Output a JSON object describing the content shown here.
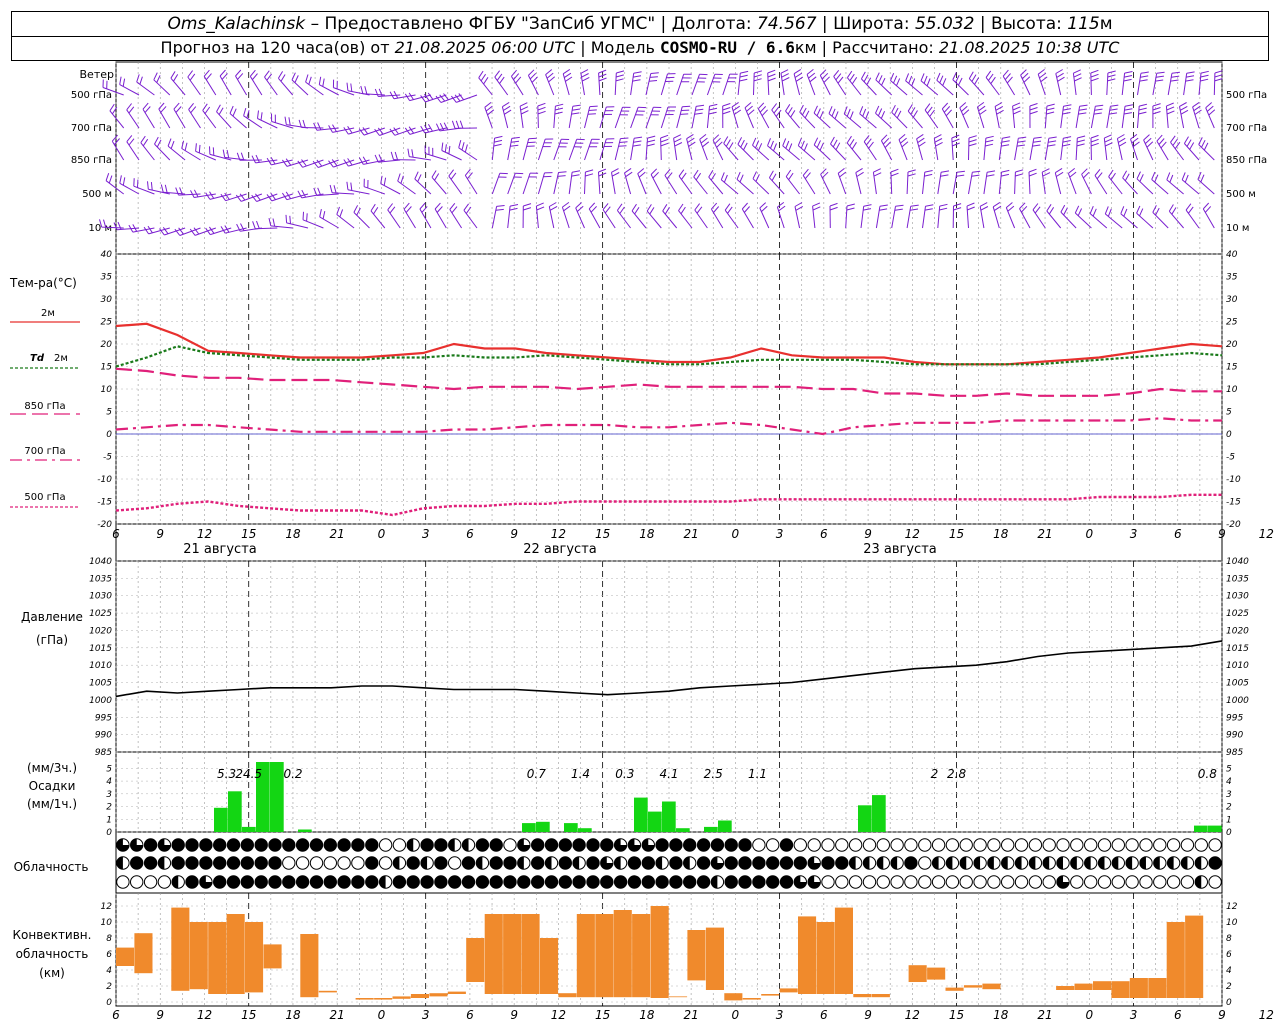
{
  "header": {
    "station": "Oms_Kalachinsk",
    "provider": "– Предоставлено ФГБУ \"ЗапСиб УГМС\"",
    "lon_label": "Долгота:",
    "lon": "74.567",
    "lat_label": "Широта:",
    "lat": "55.032",
    "alt_label": "Высота:",
    "alt": "115",
    "alt_unit": "м",
    "forecast_prefix": "Прогноз на 120 часа(ов) от",
    "forecast_time": "21.08.2025 06:00 UTC",
    "model_label": "Модель",
    "model": "COSMO-RU / 6.6",
    "model_unit": "км",
    "computed_label": "Рассчитано:",
    "computed": "21.08.2025 10:38 UTC"
  },
  "labels": {
    "wind": "Ветер",
    "levels": [
      "500 гПа",
      "700 гПа",
      "850 гПа",
      "500 м",
      "10 м"
    ],
    "temp_title": "Тем-ра(°С)",
    "legend_2m": "2м",
    "legend_td_a": "Td",
    "legend_td_b": "2м",
    "legend_850": "850 гПа",
    "legend_700": "700 гПа",
    "legend_500": "500 гПа",
    "pressure_title": "Давление",
    "pressure_unit": "(гПа)",
    "precip_unit1": "(мм/3ч.)",
    "precip_title": "Осадки",
    "precip_unit2": "(мм/1ч.)",
    "cloud_title": "Облачность",
    "conv_title1": "Конвективн.",
    "conv_title2": "облачность",
    "conv_title3": "(км)",
    "dates": [
      "21 августа",
      "22 августа",
      "23 августа"
    ]
  },
  "chart_data": [
    {
      "type": "line",
      "panel": "temperature",
      "title": "Тем-ра(°С)",
      "ylim": [
        -20,
        40
      ],
      "x_hours": [
        0,
        3,
        6,
        9,
        12,
        15,
        18,
        21,
        24,
        27,
        30,
        33,
        36,
        39,
        42,
        45,
        48,
        51,
        54,
        57,
        60,
        63,
        66,
        69,
        72,
        75,
        78,
        81,
        84,
        87,
        90,
        93,
        96,
        99,
        102,
        105,
        108,
        111,
        114,
        117,
        120,
        123,
        126,
        129,
        132,
        135,
        138,
        141,
        144
      ],
      "x_ticks": [
        "6",
        "9",
        "12",
        "15",
        "18",
        "21",
        "0",
        "3",
        "6",
        "9",
        "12",
        "15",
        "18",
        "21",
        "0",
        "3",
        "6",
        "9",
        "12",
        "15",
        "18",
        "21",
        "0",
        "3",
        "6",
        "9",
        "12"
      ],
      "series": [
        {
          "name": "2м",
          "color": "#e8302e",
          "values": [
            24,
            24.5,
            22,
            18.5,
            18,
            17.5,
            17,
            17,
            17,
            17.5,
            18,
            20,
            19,
            19,
            18,
            17.5,
            17,
            16.5,
            16,
            16,
            17,
            19,
            17.5,
            17,
            17,
            17,
            16,
            15.5,
            15.5,
            15.5,
            16,
            16.5,
            17,
            18,
            19,
            20,
            19.5
          ]
        },
        {
          "name": "Td 2м",
          "color": "#1a7a1a",
          "values": [
            15,
            17,
            19.5,
            18,
            17.5,
            17,
            16.5,
            16.5,
            16.5,
            17,
            17,
            17.5,
            17,
            17,
            17.5,
            17,
            16.5,
            16,
            15.5,
            15.5,
            16,
            16.5,
            16.5,
            16.5,
            16.5,
            16,
            15.5,
            15.5,
            15.5,
            15.5,
            15.5,
            16,
            16.5,
            17,
            17.5,
            18,
            17.5
          ]
        },
        {
          "name": "850 гПа",
          "color": "#e0207a",
          "values": [
            14.5,
            14,
            13,
            12.5,
            12.5,
            12,
            12,
            12,
            11.5,
            11,
            10.5,
            10,
            10.5,
            10.5,
            10.5,
            10,
            10.5,
            11,
            10.5,
            10.5,
            10.5,
            10.5,
            10.5,
            10,
            10,
            9,
            9,
            8.5,
            8.5,
            9,
            8.5,
            8.5,
            8.5,
            9,
            10,
            9.5,
            9.5
          ]
        },
        {
          "name": "700 гПа",
          "color": "#e0207a",
          "values": [
            1,
            1.5,
            2,
            2,
            1.5,
            1,
            0.5,
            0.5,
            0.5,
            0.5,
            0.5,
            1,
            1,
            1.5,
            2,
            2,
            2,
            1.5,
            1.5,
            2,
            2.5,
            2,
            1,
            0,
            1.5,
            2,
            2.5,
            2.5,
            2.5,
            3,
            3,
            3,
            3,
            3,
            3.5,
            3,
            3
          ]
        },
        {
          "name": "500 гПа",
          "color": "#e0207a",
          "values": [
            -17,
            -16.5,
            -15.5,
            -15,
            -16,
            -16.5,
            -17,
            -17,
            -17,
            -18,
            -16.5,
            -16,
            -16,
            -15.5,
            -15.5,
            -15,
            -15,
            -15,
            -15,
            -15,
            -15,
            -14.5,
            -14.5,
            -14.5,
            -14.5,
            -14.5,
            -14.5,
            -14.5,
            -14.5,
            -14.5,
            -14.5,
            -14.5,
            -14,
            -14,
            -14,
            -13.5,
            -13.5
          ]
        }
      ]
    },
    {
      "type": "line",
      "panel": "pressure",
      "title": "Давление",
      "ylabel": "(гПа)",
      "ylim": [
        985,
        1040
      ],
      "series": [
        {
          "name": "Давление",
          "color": "#000000",
          "values": [
            1001,
            1002.5,
            1002,
            1002.5,
            1003,
            1003.5,
            1003.5,
            1003.5,
            1004,
            1004,
            1003.5,
            1003,
            1003,
            1003,
            1002.5,
            1002,
            1001.5,
            1002,
            1002.5,
            1003.5,
            1004,
            1004.5,
            1005,
            1006,
            1007,
            1008,
            1009,
            1009.5,
            1010,
            1011,
            1012.5,
            1013.5,
            1014,
            1014.5,
            1015,
            1015.5,
            1017
          ]
        }
      ]
    },
    {
      "type": "bar",
      "panel": "precipitation",
      "ylim": [
        0,
        5.5
      ],
      "labels_3h": [
        {
          "hour": 15,
          "text": "5.3"
        },
        {
          "hour": 18,
          "text": "24.5"
        },
        {
          "hour": 24,
          "text": "0.2"
        },
        {
          "hour": 57,
          "text": "0.7"
        },
        {
          "hour": 63,
          "text": "1.4"
        },
        {
          "hour": 69,
          "text": "0.3"
        },
        {
          "hour": 75,
          "text": "4.1"
        },
        {
          "hour": 81,
          "text": "2.5"
        },
        {
          "hour": 87,
          "text": "1.1"
        },
        {
          "hour": 111,
          "text": "2"
        },
        {
          "hour": 114,
          "text": "2.8"
        },
        {
          "hour": 183,
          "text": "0.8"
        }
      ],
      "bars": [
        [
          7,
          1.9
        ],
        [
          8,
          3.2
        ],
        [
          9,
          0.4
        ],
        [
          10,
          5.5
        ],
        [
          11,
          5.5
        ],
        [
          13,
          0.2
        ],
        [
          29,
          0.7
        ],
        [
          30,
          0.8
        ],
        [
          32,
          0.7
        ],
        [
          33,
          0.3
        ],
        [
          37,
          2.7
        ],
        [
          38,
          1.6
        ],
        [
          39,
          2.4
        ],
        [
          40,
          0.3
        ],
        [
          42,
          0.4
        ],
        [
          43,
          0.9
        ],
        [
          53,
          2.1
        ],
        [
          54,
          2.9
        ],
        [
          77,
          0.5
        ],
        [
          78,
          0.5
        ]
      ]
    },
    {
      "type": "bar",
      "panel": "convective_cloud",
      "title": "Конвективн. облачность (км)",
      "ylim": [
        0,
        13
      ],
      "bars": [
        [
          0,
          4.5,
          6.8
        ],
        [
          1,
          3.6,
          8.6
        ],
        [
          3,
          1.4,
          11.8
        ],
        [
          4,
          1.6,
          10
        ],
        [
          5,
          1,
          10
        ],
        [
          6,
          1,
          11
        ],
        [
          7,
          1.2,
          10
        ],
        [
          8,
          4.2,
          7.2
        ],
        [
          10,
          0.6,
          8.5
        ],
        [
          11,
          1.2,
          1.4
        ],
        [
          13,
          0.3,
          0.5
        ],
        [
          14,
          0.3,
          0.5
        ],
        [
          15,
          0.4,
          0.7
        ],
        [
          16,
          0.5,
          1
        ],
        [
          17,
          0.7,
          1.1
        ],
        [
          18,
          1,
          1.3
        ],
        [
          19,
          2.5,
          8
        ],
        [
          20,
          1,
          11
        ],
        [
          21,
          1,
          11
        ],
        [
          22,
          1,
          11
        ],
        [
          23,
          1,
          8
        ],
        [
          24,
          0.6,
          1.1
        ],
        [
          25,
          0.6,
          11
        ],
        [
          26,
          0.6,
          11
        ],
        [
          27,
          0.6,
          11.5
        ],
        [
          28,
          0.6,
          11
        ],
        [
          29,
          0.5,
          12
        ],
        [
          30,
          0.6,
          0.7
        ],
        [
          31,
          2.7,
          9
        ],
        [
          32,
          1.5,
          9.3
        ],
        [
          33,
          0.2,
          1.1
        ],
        [
          34,
          0.3,
          0.5
        ],
        [
          35,
          0.8,
          1
        ],
        [
          36,
          1.2,
          1.7
        ],
        [
          37,
          1,
          10.7
        ],
        [
          38,
          1,
          10
        ],
        [
          39,
          1,
          11.8
        ],
        [
          40,
          0.6,
          1
        ],
        [
          41,
          0.6,
          1
        ],
        [
          43,
          2.5,
          4.6
        ],
        [
          44,
          2.8,
          4.3
        ],
        [
          45,
          1.4,
          1.8
        ],
        [
          46,
          1.8,
          2.1
        ],
        [
          47,
          1.6,
          2.3
        ],
        [
          51,
          1.5,
          2
        ],
        [
          52,
          1.5,
          2.3
        ],
        [
          53,
          1.5,
          2.6
        ],
        [
          54,
          0.5,
          2.6
        ],
        [
          55,
          0.5,
          3
        ],
        [
          56,
          0.5,
          3
        ],
        [
          57,
          0.5,
          10
        ],
        [
          58,
          0.5,
          10.8
        ]
      ]
    }
  ],
  "cloud_rows": [
    "331311111111111111100211221103111111333111111100100000000000000000000000000000003",
    "211211111111000000102121012112121213211212131111113112222102222222222222222222211",
    "000021311111111111121111111111111111111111121111133000000000000000003000000000201"
  ],
  "wind_rows": [
    "500 гПа",
    "700 гПа",
    "850 гПа",
    "500 м",
    "10 м"
  ]
}
